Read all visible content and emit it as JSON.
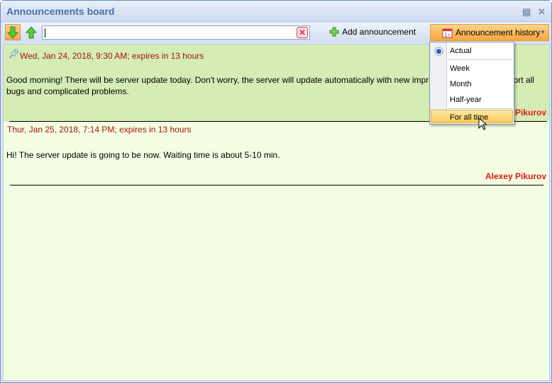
{
  "window": {
    "title": "Announcements board"
  },
  "toolbar": {
    "search_value": "",
    "add_label": "Add announcement",
    "history_label": "Announcement history"
  },
  "announcements": [
    {
      "header": "Wed, Jan 24, 2018, 9:30 AM; expires in 13 hours",
      "pinned": true,
      "body": "Good morning! There will be server update today. Don't worry, the server will update automatically with new improvements. Please, report all bugs and complicated problems.",
      "author": "Alexey Pikurov"
    },
    {
      "header": "Thur, Jan 25, 2018, 7:14 PM; expires in 13 hours",
      "pinned": false,
      "body": "Hi! The server update is going to be now. Waiting time is about 5-10 min.",
      "author": "Alexey Pikurov"
    }
  ],
  "history_menu": {
    "items": [
      "Actual",
      "Week",
      "Month",
      "Half-year",
      "For all time"
    ],
    "selected": "Actual",
    "hovered": "For all time"
  },
  "colors": {
    "pinned_bg": "#d5ecb4",
    "content_bg": "#f3fde2",
    "header_text": "#a31515",
    "author_text": "#e41b1b",
    "accent": "#f6a63d"
  }
}
